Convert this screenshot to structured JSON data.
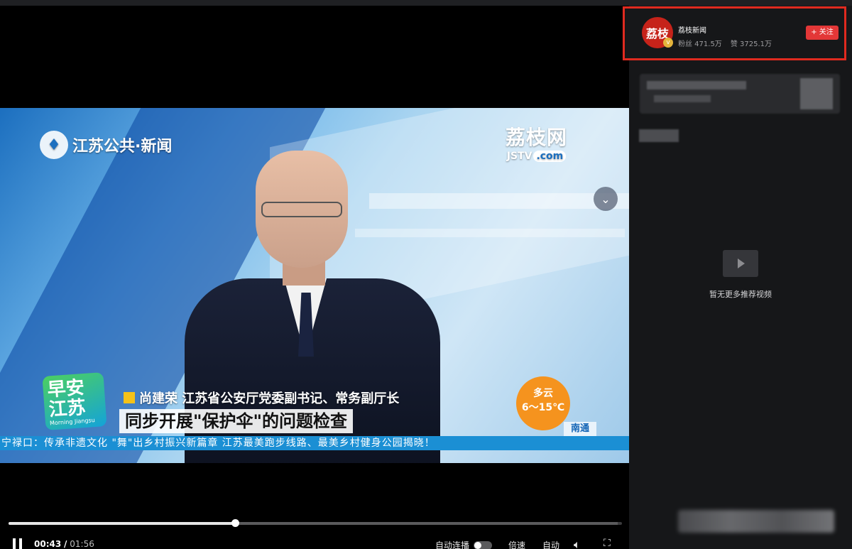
{
  "video": {
    "channel_logo": "江苏公共·新闻",
    "watermark_top": "荔枝网",
    "watermark_bottom": "JSTV",
    "watermark_com": ".com",
    "show_badge": "早安江苏",
    "show_badge_sub": "Morning Jiangsu",
    "speaker_line": "尚建荣 江苏省公安厅党委副书记、常务副厅长",
    "headline": "同步开展\"保护伞\"的问题检查",
    "weather_condition": "多云",
    "weather_temp": "6～15℃",
    "city": "南通",
    "ticker": "宁禄口：传承非遗文化 \"舞\"出乡村振兴新篇章    江苏最美跑步线路、最美乡村健身公园揭晓！"
  },
  "controls": {
    "current_time": "00:43",
    "separator": "/",
    "total_time": "01:56",
    "progress_fraction": 0.37,
    "autoplay_label": "自动连播",
    "autoplay_on": false,
    "speed_label": "倍速",
    "quality_label": "自动"
  },
  "author": {
    "avatar_text": "荔枝",
    "name": "荔枝新闻",
    "fans": "粉丝 471.5万",
    "likes": "赞 3725.1万",
    "follow_label": "+ 关注"
  },
  "recommend": {
    "empty_message": "暂无更多推荐视频"
  },
  "colors": {
    "follow_red": "#e33737",
    "highlight_border": "#e02a1f",
    "sidebar_bg": "#161719"
  }
}
